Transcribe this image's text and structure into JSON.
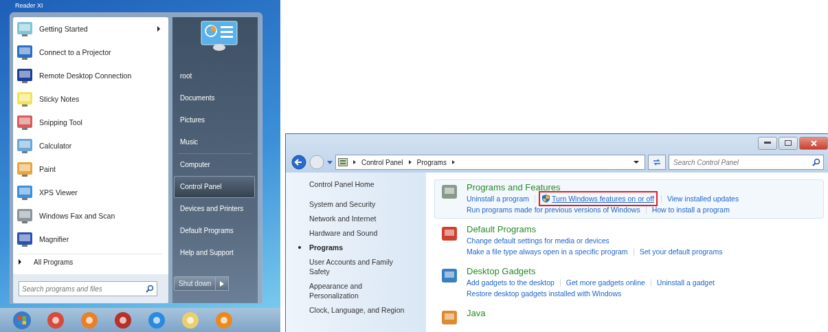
{
  "desktop": {
    "label": "Reader XI"
  },
  "start_menu": {
    "programs": [
      {
        "label": "Getting Started",
        "submenu": true
      },
      {
        "label": "Connect to a Projector",
        "submenu": false
      },
      {
        "label": "Remote Desktop Connection",
        "submenu": false
      },
      {
        "label": "Sticky Notes",
        "submenu": false
      },
      {
        "label": "Snipping Tool",
        "submenu": false
      },
      {
        "label": "Calculator",
        "submenu": false
      },
      {
        "label": "Paint",
        "submenu": false
      },
      {
        "label": "XPS Viewer",
        "submenu": false
      },
      {
        "label": "Windows Fax and Scan",
        "submenu": false
      },
      {
        "label": "Magnifier",
        "submenu": false
      }
    ],
    "all_programs": "All Programs",
    "search": {
      "placeholder": "Search programs and files"
    },
    "places": [
      {
        "label": "root",
        "selected": false,
        "divider_after": false
      },
      {
        "label": "Documents",
        "selected": false,
        "divider_after": false
      },
      {
        "label": "Pictures",
        "selected": false,
        "divider_after": false
      },
      {
        "label": "Music",
        "selected": false,
        "divider_after": true
      },
      {
        "label": "Computer",
        "selected": false,
        "divider_after": false
      },
      {
        "label": "Control Panel",
        "selected": true,
        "divider_after": false
      },
      {
        "label": "Devices and Printers",
        "selected": false,
        "divider_after": false
      },
      {
        "label": "Default Programs",
        "selected": false,
        "divider_after": false
      },
      {
        "label": "Help and Support",
        "selected": false,
        "divider_after": false
      }
    ],
    "shutdown": "Shut down"
  },
  "control_panel": {
    "breadcrumb": [
      "Control Panel",
      "Programs"
    ],
    "search": {
      "placeholder": "Search Control Panel"
    },
    "nav": [
      {
        "label": "Control Panel Home",
        "selected": false
      },
      {
        "label": "System and Security",
        "selected": false
      },
      {
        "label": "Network and Internet",
        "selected": false
      },
      {
        "label": "Hardware and Sound",
        "selected": false
      },
      {
        "label": "Programs",
        "selected": true
      },
      {
        "label": "User Accounts and Family Safety",
        "selected": false
      },
      {
        "label": "Appearance and Personalization",
        "selected": false
      },
      {
        "label": "Clock, Language, and Region",
        "selected": false
      }
    ],
    "categories": [
      {
        "title": "Programs and Features",
        "highlighted": true,
        "link_rows": [
          [
            {
              "text": "Uninstall a program",
              "shield": false,
              "outlined": false
            },
            {
              "text": "Turn Windows features on or off",
              "shield": true,
              "outlined": true
            },
            {
              "text": "View installed updates",
              "shield": false,
              "outlined": false
            }
          ],
          [
            {
              "text": "Run programs made for previous versions of Windows",
              "shield": false,
              "outlined": false
            },
            {
              "text": "How to install a program",
              "shield": false,
              "outlined": false
            }
          ]
        ]
      },
      {
        "title": "Default Programs",
        "highlighted": false,
        "link_rows": [
          [
            {
              "text": "Change default settings for media or devices",
              "shield": false,
              "outlined": false
            }
          ],
          [
            {
              "text": "Make a file type always open in a specific program",
              "shield": false,
              "outlined": false
            },
            {
              "text": "Set your default programs",
              "shield": false,
              "outlined": false
            }
          ]
        ]
      },
      {
        "title": "Desktop Gadgets",
        "highlighted": false,
        "link_rows": [
          [
            {
              "text": "Add gadgets to the desktop",
              "shield": false,
              "outlined": false
            },
            {
              "text": "Get more gadgets online",
              "shield": false,
              "outlined": false
            },
            {
              "text": "Uninstall a gadget",
              "shield": false,
              "outlined": false
            }
          ],
          [
            {
              "text": "Restore desktop gadgets installed with Windows",
              "shield": false,
              "outlined": false
            }
          ]
        ]
      },
      {
        "title": "Java",
        "highlighted": false
      }
    ]
  }
}
